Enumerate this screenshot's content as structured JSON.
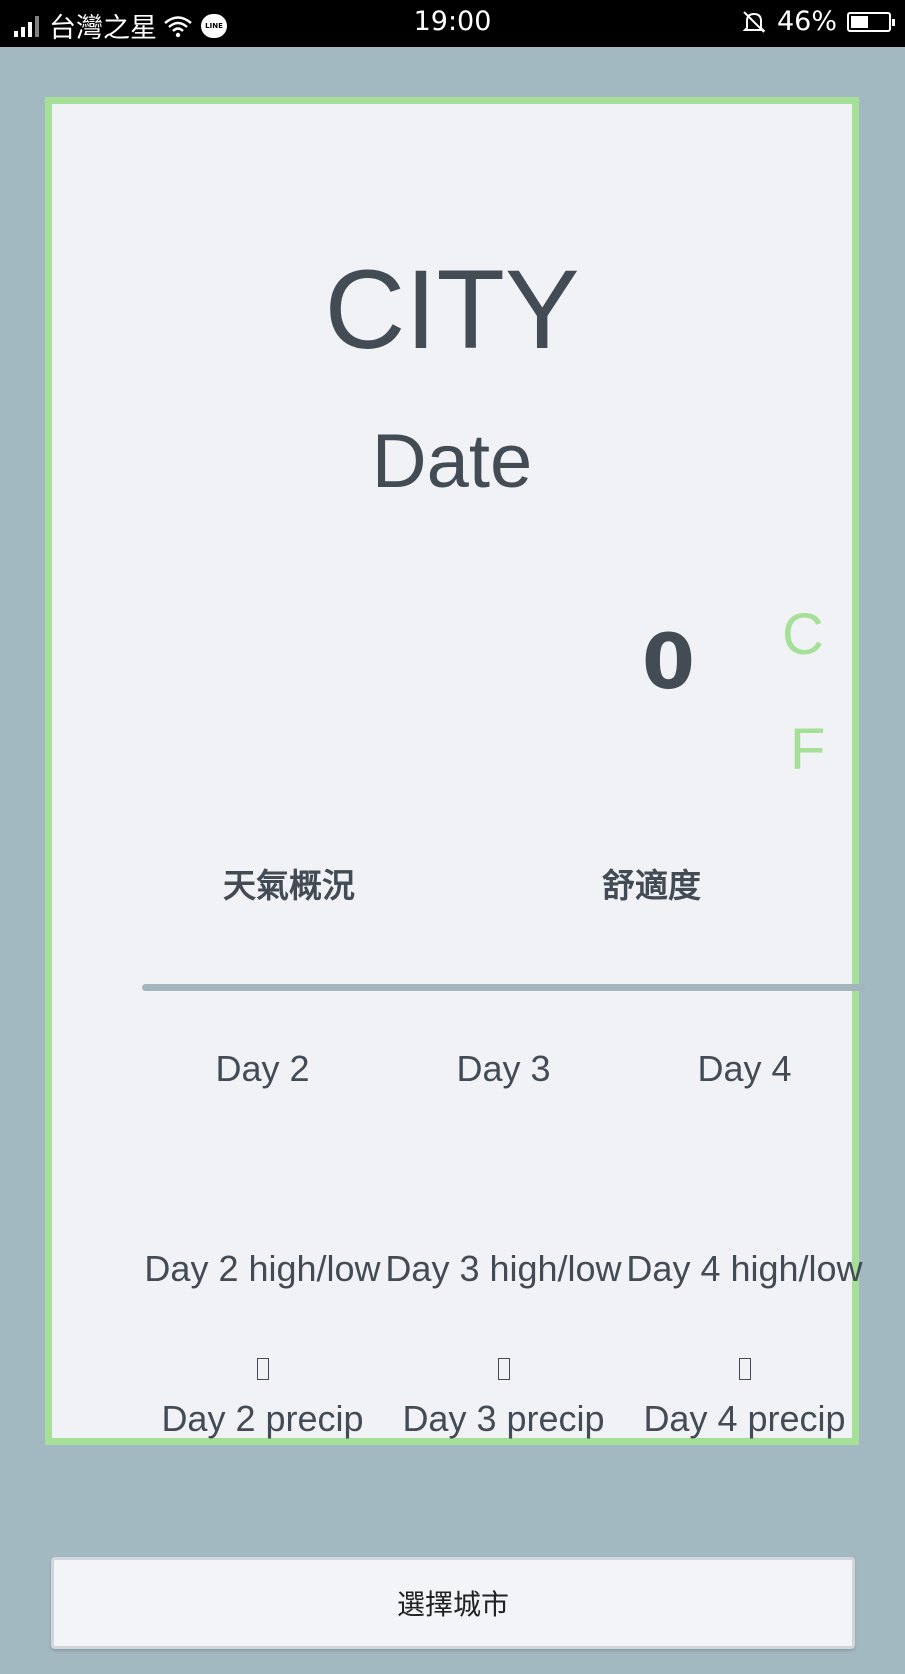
{
  "status_bar": {
    "carrier": "台灣之星",
    "line_badge": "LINE",
    "time": "19:00",
    "battery_percent_text": "46%",
    "battery_level": 0.46
  },
  "card": {
    "city": "CITY",
    "date": "Date",
    "temperature": "0",
    "unit_celsius": "C",
    "unit_fahrenheit": "F",
    "condition_label": "天氣概況",
    "comfort_label": "舒適度"
  },
  "forecast": [
    {
      "day": "Day 2",
      "high_low": "Day 2 high/low",
      "precip": "Day 2 precip"
    },
    {
      "day": "Day 3",
      "high_low": "Day 3 high/low",
      "precip": "Day 3 precip"
    },
    {
      "day": "Day 4",
      "high_low": "Day 4 high/low",
      "precip": "Day 4 precip"
    }
  ],
  "select_city_button": "選擇城市",
  "colors": {
    "background": "#a3b9c2",
    "card": "#f0f2f5",
    "accent": "#a6df98",
    "text": "#434b55"
  }
}
